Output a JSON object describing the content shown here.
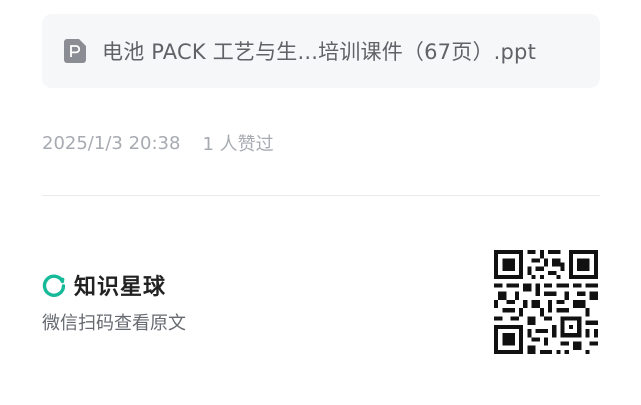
{
  "attachment": {
    "file_name": "电池 PACK 工艺与生...培训课件（67页）.ppt",
    "icon": "file-ppt-icon"
  },
  "meta": {
    "datetime": "2025/1/3 20:38",
    "likes": "1 人赞过"
  },
  "footer": {
    "brand_name": "知识星球",
    "brand_icon": "zsxq-logo-icon",
    "scan_hint": "微信扫码查看原文",
    "qr_icon": "qr-code-icon",
    "brand_color": "#16b998"
  }
}
